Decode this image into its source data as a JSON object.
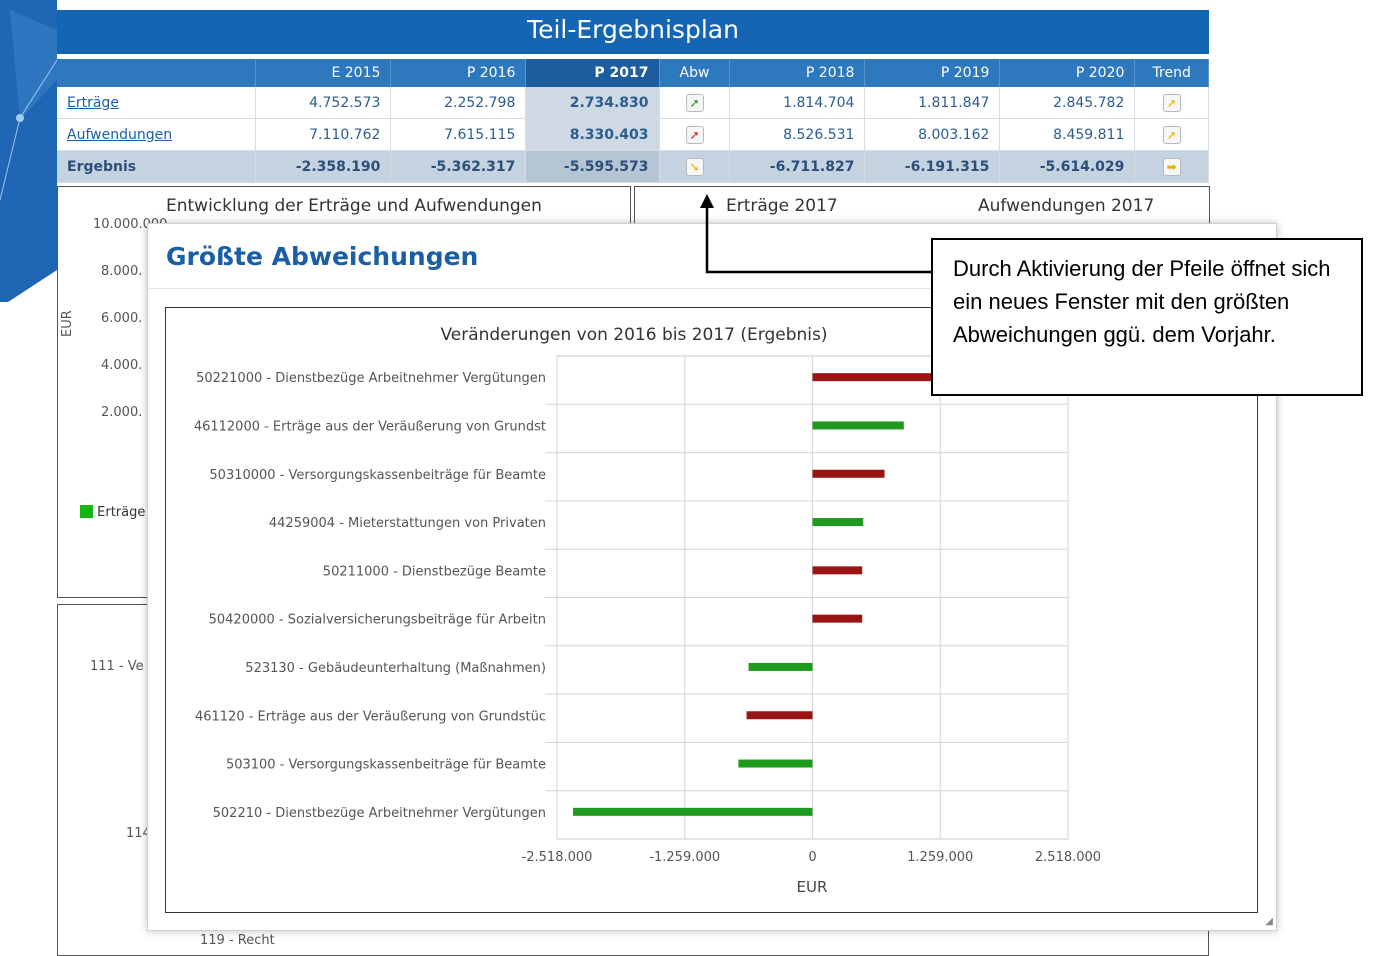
{
  "page_title": "Teil-Ergebnisplan",
  "table": {
    "headers": [
      "",
      "E 2015",
      "P 2016",
      "P 2017",
      "Abw",
      "P 2018",
      "P 2019",
      "P 2020",
      "Trend"
    ],
    "rows": [
      {
        "label": "Erträge",
        "values": [
          "4.752.573",
          "2.252.798",
          "2.734.830",
          "",
          "1.814.704",
          "1.811.847",
          "2.845.782",
          ""
        ],
        "abw_icon": "arrow-up-right-green",
        "trend_icon": "arrow-up-right-yellow"
      },
      {
        "label": "Aufwendungen",
        "values": [
          "7.110.762",
          "7.615.115",
          "8.330.403",
          "",
          "8.526.531",
          "8.003.162",
          "8.459.811",
          ""
        ],
        "abw_icon": "arrow-up-right-red",
        "trend_icon": "arrow-up-right-yellow"
      },
      {
        "label": "Ergebnis",
        "values": [
          "-2.358.190",
          "-5.362.317",
          "-5.595.573",
          "",
          "-6.711.827",
          "-6.191.315",
          "-5.614.029",
          ""
        ],
        "abw_icon": "arrow-down-right-yellow",
        "trend_icon": "arrow-right-yellow"
      }
    ]
  },
  "left_panel": {
    "title": "Entwicklung der Erträge und Aufwendungen",
    "y_ticks": [
      "10.000.000",
      "8.000.",
      "6.000.",
      "4.000.",
      "2.000."
    ],
    "y_axis_label": "EUR",
    "legend_item": "Erträge"
  },
  "right_panel": {
    "title_left": "Erträge 2017",
    "title_right": "Aufwendungen 2017"
  },
  "bottom_panel": {
    "row_labels": [
      "111 - Ve",
      "114",
      "119 - Recht"
    ]
  },
  "modal": {
    "title": "Größte Abweichungen"
  },
  "callout": {
    "text": "Durch Aktivierung der Pfeile öffnet sich ein neues Fenster mit den größten Abweichungen ggü. dem Vorjahr."
  },
  "chart_data": {
    "type": "bar",
    "orientation": "horizontal",
    "title": "Veränderungen von 2016 bis 2017 (Ergebnis)",
    "xlabel": "EUR",
    "ylabel": "",
    "xlim": [
      -2518000,
      2518000
    ],
    "x_ticks": [
      -2518000,
      -1259000,
      0,
      1259000,
      2518000
    ],
    "x_tick_labels": [
      "-2.518.000",
      "-1.259.000",
      "0",
      "1.259.000",
      "2.518.000"
    ],
    "grid": true,
    "categories": [
      "50221000 - Dienstbezüge Arbeitnehmer Vergütungen",
      "46112000 - Erträge aus der Veräußerung von Grundst",
      "50310000 - Versorgungskassenbeiträge für Beamte",
      "44259004 - Mieterstattungen von Privaten",
      "50211000 - Dienstbezüge Beamte",
      "50420000 - Sozialversicherungsbeiträge für Arbeitn",
      "523130 - Gebäudeunterhaltung (Maßnahmen)",
      "461120 - Erträge aus der Veräußerung von Grundstüc",
      "503100 - Versorgungskassenbeiträge für Beamte",
      "502210 - Dienstbezüge Arbeitnehmer Vergütungen"
    ],
    "values": [
      1290000,
      900000,
      710000,
      500000,
      490000,
      490000,
      -630000,
      -650000,
      -730000,
      -2360000
    ],
    "colors": [
      "#9b1414",
      "#1e9a1e",
      "#9b1414",
      "#1e9a1e",
      "#9b1414",
      "#9b1414",
      "#1e9a1e",
      "#9b1414",
      "#1e9a1e",
      "#1e9a1e"
    ]
  }
}
